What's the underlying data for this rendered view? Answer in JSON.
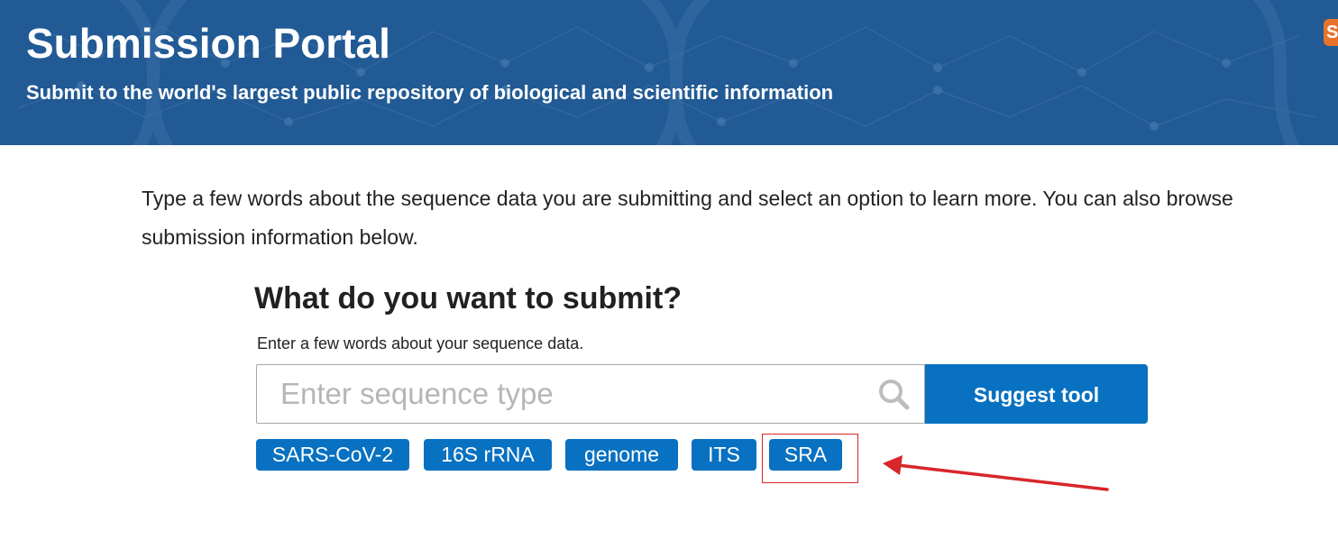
{
  "banner": {
    "title": "Submission Portal",
    "subtitle": "Submit to the world's largest public repository of biological and scientific information",
    "background_color": "#215a94",
    "corner_badge_text": "S"
  },
  "intro": {
    "text": "Type a few words about the sequence data you are submitting and select an option to learn more. You can also browse submission information below."
  },
  "search": {
    "heading": "What do you want to submit?",
    "hint": "Enter a few words about your sequence data.",
    "placeholder": "Enter sequence type",
    "value": "",
    "icon": "search-icon",
    "button_label": "Suggest tool",
    "accent_color": "#0871c1"
  },
  "chips": [
    {
      "label": "SARS-CoV-2"
    },
    {
      "label": "16S rRNA"
    },
    {
      "label": "genome"
    },
    {
      "label": "ITS"
    },
    {
      "label": "SRA"
    }
  ],
  "annotation": {
    "highlighted_chip": "SRA",
    "color": "#d8262b"
  }
}
